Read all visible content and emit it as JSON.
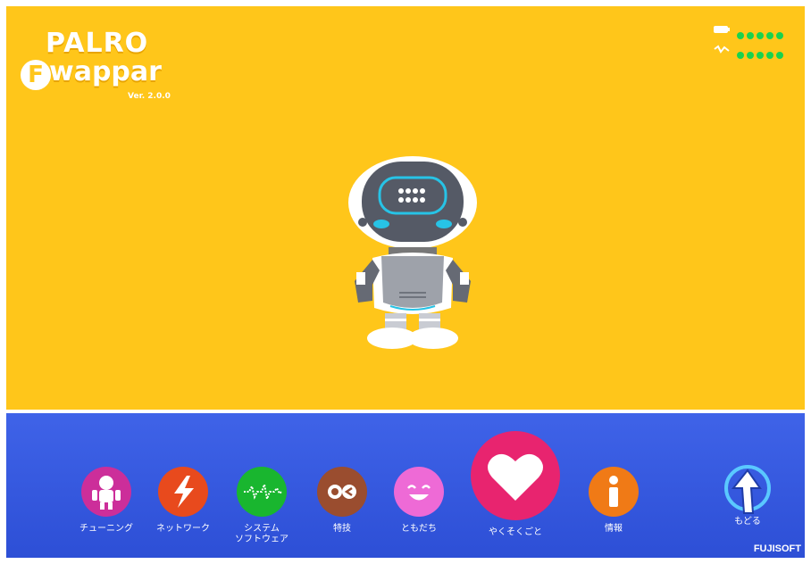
{
  "app": {
    "logo_palro": "PALRO",
    "logo_f": "F",
    "logo_wappar": "wappar",
    "version": "Ver. 2.0.0"
  },
  "status": {
    "battery_level_dots": 5,
    "signal_level_dots": 5,
    "accent": "#19d24d"
  },
  "nav": {
    "items": [
      {
        "label": "チューニング",
        "icon": "robot-figure-icon",
        "color": "#cc2e9a"
      },
      {
        "label": "ネットワーク",
        "icon": "lightning-icon",
        "color": "#e84a1d"
      },
      {
        "label": "システム\nソフトウェア",
        "icon": "waveform-icon",
        "color": "#19b62f"
      },
      {
        "label": "特技",
        "icon": "eyes-icon",
        "color": "#9a4d2f"
      },
      {
        "label": "ともだち",
        "icon": "smiley-icon",
        "color": "#ee6ad6"
      },
      {
        "label": "やくそくごと",
        "icon": "heart-icon",
        "color": "#e8246f"
      },
      {
        "label": "情報",
        "icon": "info-icon",
        "color": "#f07a16"
      },
      {
        "label": "もどる",
        "icon": "back-arrow-icon",
        "color": "#ffffff"
      }
    ]
  },
  "footer": {
    "brand": "FUJISOFT"
  },
  "colors": {
    "stage": "#FFC61A",
    "bar": "#3558e0"
  }
}
